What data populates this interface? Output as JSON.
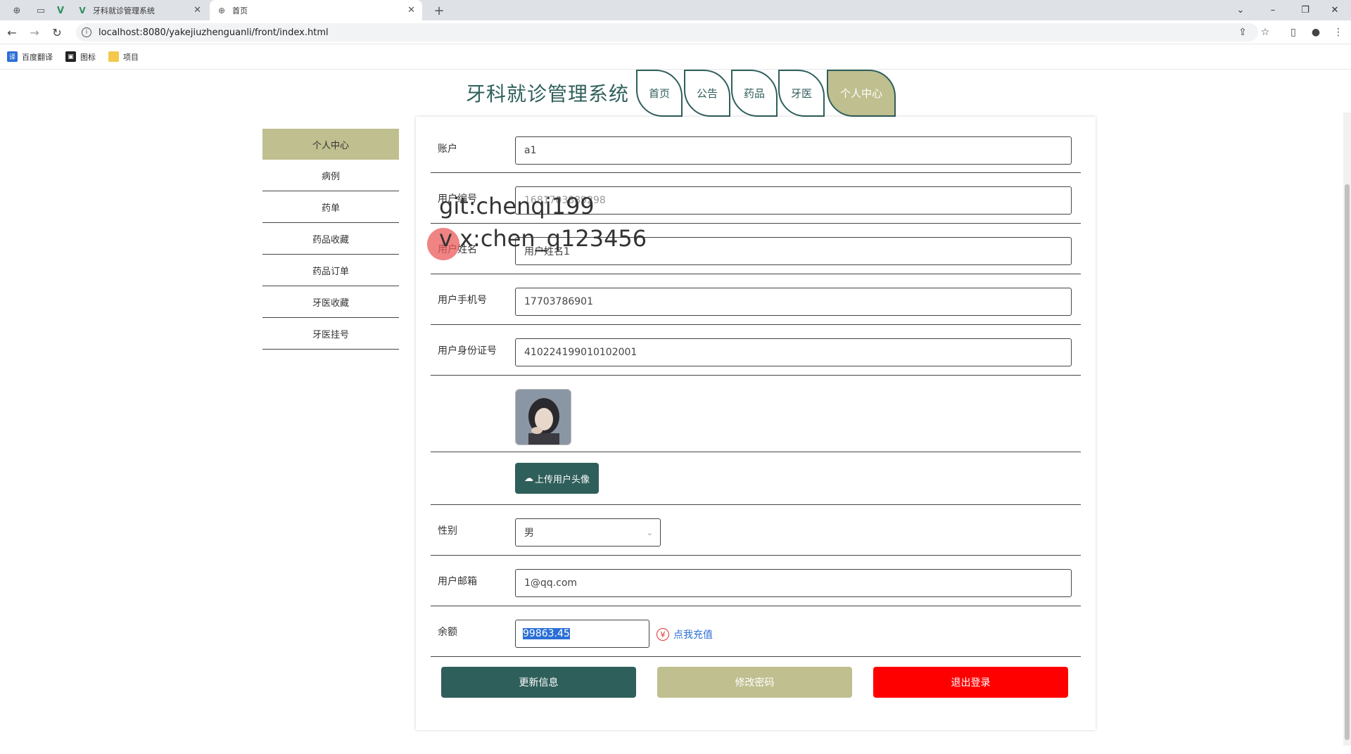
{
  "browser": {
    "tabs": [
      {
        "title": "",
        "icon": "globe-icon"
      },
      {
        "title": "",
        "icon": "blank-page-icon"
      },
      {
        "title": "",
        "icon": "vue-icon"
      },
      {
        "title": "牙科就诊管理系统",
        "icon": "vue-icon"
      },
      {
        "title": "首页",
        "icon": "globe-icon"
      }
    ],
    "url": "localhost:8080/yakejiuzhenguanli/front/index.html",
    "bookmarks": [
      {
        "label": "百度翻译",
        "icon": "translate-icon",
        "color": "#2b6fd6"
      },
      {
        "label": "图标",
        "icon": "image-icon",
        "color": "#222222"
      },
      {
        "label": "项目",
        "icon": "folder-icon",
        "color": "#f2c94c"
      }
    ]
  },
  "site": {
    "title": "牙科就诊管理系统",
    "nav": [
      "首页",
      "公告",
      "药品",
      "牙医",
      "个人中心"
    ],
    "active_nav": "个人中心"
  },
  "sidebar": {
    "items": [
      "个人中心",
      "病例",
      "药单",
      "药品收藏",
      "药品订单",
      "牙医收藏",
      "牙医挂号"
    ],
    "active": "个人中心"
  },
  "form": {
    "account": {
      "label": "账户",
      "value": "a1"
    },
    "user_id": {
      "label": "用户编号",
      "value": "1681703889298"
    },
    "user_name": {
      "label": "用户姓名",
      "value": "用户姓名1"
    },
    "phone": {
      "label": "用户手机号",
      "value": "17703786901"
    },
    "id_card": {
      "label": "用户身份证号",
      "value": "410224199010102001"
    },
    "upload_label": "上传用户头像",
    "gender": {
      "label": "性别",
      "value": "男"
    },
    "email": {
      "label": "用户邮箱",
      "value": "1@qq.com"
    },
    "balance": {
      "label": "余额",
      "value": "99863.45",
      "recharge_label": "点我充值"
    }
  },
  "actions": {
    "update": "更新信息",
    "change_password": "修改密码",
    "logout": "退出登录"
  },
  "colors": {
    "primary": "#2f5f5b",
    "accent": "#bfbf8f",
    "danger": "#ff0000",
    "link": "#2b6fd6"
  },
  "watermark": {
    "line1": "git:chenqi199",
    "line2": "v x:chen_q123456"
  }
}
